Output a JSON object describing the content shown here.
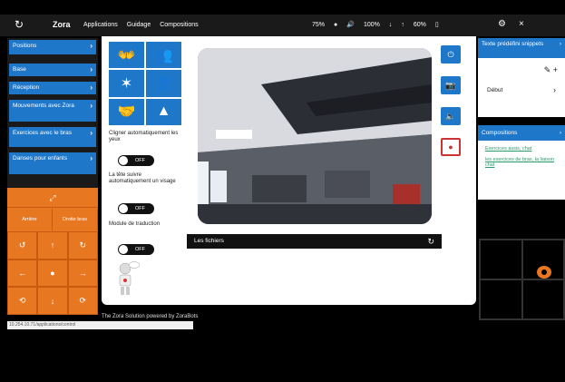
{
  "topbar": {
    "refresh_icon": "refresh-icon",
    "brand": "Zora",
    "menu": [
      "Applications",
      "Guidage",
      "Compositions"
    ],
    "volume_level": "75%",
    "battery_level": "100%",
    "wifi_level": "60%",
    "settings_icon": "gear-icon",
    "close_icon": "close-icon"
  },
  "left": {
    "items": [
      {
        "label": "Positions"
      },
      {
        "label": "Base"
      },
      {
        "label": "Réception"
      },
      {
        "label": "Mouvements avec Zora"
      },
      {
        "label": "Exercices avec le bras"
      },
      {
        "label": "Danses pour enfants"
      }
    ],
    "pad": {
      "left": "Arrière",
      "right": "Droite bras"
    },
    "url": "10.254.10.71/applications/control"
  },
  "main": {
    "options": [
      {
        "label": "Cligner automatiquement les yeux",
        "state": "OFF"
      },
      {
        "label": "La tête suivre automatiquement un visage",
        "state": "OFF"
      },
      {
        "label": "Module de traduction",
        "state": "OFF"
      }
    ],
    "files_label": "Les fichiers",
    "footer": "The Zora Solution powered by ZoraBots"
  },
  "right": {
    "panel1_title": "Texte prédéfini snippets",
    "panel1_item": "Début",
    "panel2_title": "Compositions",
    "panel2_links": [
      "Exercices assis, chat",
      "les exercices de bras, la liaison chat"
    ]
  }
}
